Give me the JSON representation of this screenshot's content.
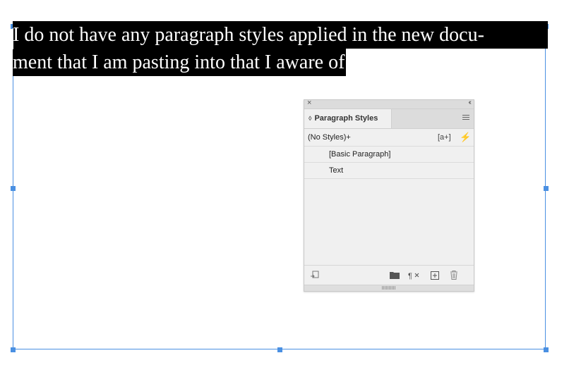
{
  "document": {
    "text_lines": [
      "I do not have any paragraph styles applied in the new docu-",
      "ment that I am pasting into that I aware of"
    ]
  },
  "panel": {
    "title": "Paragraph Styles",
    "close_glyph": "×",
    "collapse_glyph": "‹‹",
    "tab_arrows": "◊",
    "current_style": "(No Styles)+",
    "new_style_badge": "[a+]",
    "quick_apply_icon": "⚡",
    "styles": [
      "[Basic Paragraph]",
      "Text"
    ],
    "bottom_icons": [
      "load-styles-icon",
      "folder-icon",
      "clear-overrides-icon",
      "new-style-icon",
      "trash-icon"
    ]
  },
  "colors": {
    "selection_bg": "#000000",
    "frame_border": "#4a90e2",
    "panel_bg": "#f0f0f0"
  }
}
